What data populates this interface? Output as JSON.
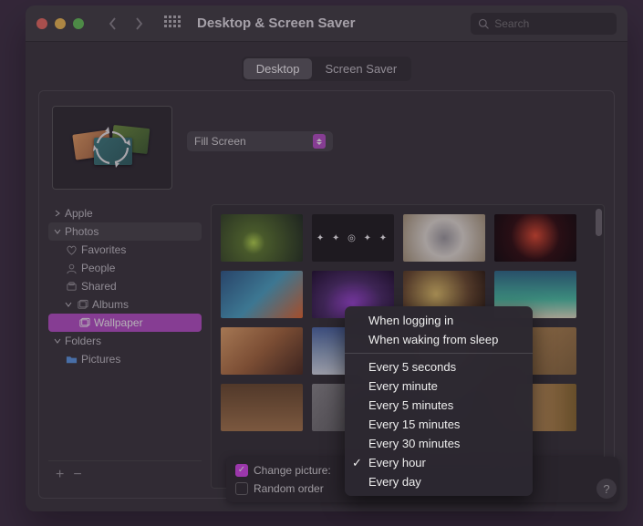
{
  "titlebar": {
    "title": "Desktop & Screen Saver",
    "search_placeholder": "Search"
  },
  "tabs": {
    "desktop": "Desktop",
    "screensaver": "Screen Saver"
  },
  "fit_select": {
    "value": "Fill Screen"
  },
  "sidebar": {
    "apple": "Apple",
    "photos": "Photos",
    "favorites": "Favorites",
    "people": "People",
    "shared": "Shared",
    "albums": "Albums",
    "wallpaper": "Wallpaper",
    "folders": "Folders",
    "pictures": "Pictures"
  },
  "bottombar": {
    "change_picture": "Change picture:",
    "random_order": "Random order"
  },
  "menu": {
    "when_logging_in": "When logging in",
    "when_waking": "When waking from sleep",
    "every_5s": "Every 5 seconds",
    "every_min": "Every minute",
    "every_5m": "Every 5 minutes",
    "every_15m": "Every 15 minutes",
    "every_30m": "Every 30 minutes",
    "every_hour": "Every hour",
    "every_day": "Every day"
  },
  "help": "?"
}
